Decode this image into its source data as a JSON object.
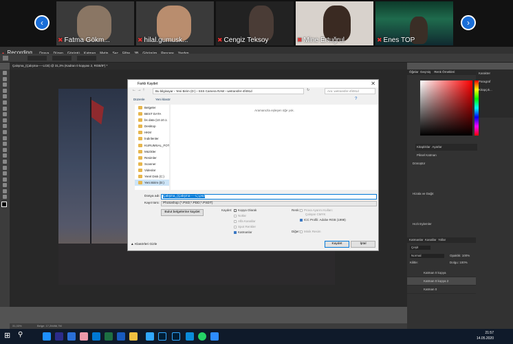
{
  "zoom": {
    "recording_label": "Recording",
    "participants": [
      {
        "name": "Fatma Gökm..."
      },
      {
        "name": "hilal.gumusk..."
      },
      {
        "name": "Cengiz Teksoy"
      },
      {
        "name": "Mine Ertuğrul"
      },
      {
        "name": "Enes TOP"
      }
    ],
    "prev_icon": "chevron-left",
    "next_icon": "chevron-right"
  },
  "ps": {
    "menu": [
      "Dosya",
      "Düzen",
      "Görüntü",
      "Katman",
      "Metin",
      "Seç",
      "Filtre",
      "3B",
      "Görünüm",
      "Pencere",
      "Yardım"
    ],
    "doc_tab": "Çalışma_(Çalışma-----LCB) @ 31,3% (Kadran 0 kopyası 2, RGB/8*) *",
    "status_zoom": "31,33%",
    "status_info": "Belge: 17,2M/86,7M",
    "right": {
      "tabs1": [
        "Kitaplıklar",
        "Ayarlar"
      ],
      "tabs2": [
        "Öğelar",
        "Geçmiş"
      ],
      "color_tab": "Renk Örnekleri",
      "side_items": [
        "Karakter",
        "Paragraf",
        "Kitapçık..."
      ],
      "props_tab": "Özellikler",
      "props_title": "Piksel Katman",
      "transform_label": "Dönüştür",
      "align_label": "Hizala ve Dağıt",
      "fx_label": "Hızlı Eylemler",
      "layers_tabs": [
        "Katmanlar",
        "Kanallar",
        "Yollar"
      ],
      "blend_mode": "Normal",
      "opacity_label": "Opaklık:",
      "opacity": "100%",
      "lock_label": "Kilitle:",
      "fill_label": "Dolgu:",
      "fill": "100%",
      "filter_label": "Çeşit",
      "layers": [
        "Katman 0 kopya",
        "Katman 0 kopya 2",
        "Katman 0"
      ]
    }
  },
  "dialog": {
    "title": "Farklı Kaydet",
    "path": [
      "Bu bilgisayar",
      "Yeni Birim (D:)",
      "SSS Camera RAW",
      "wetransfer-4f491d"
    ],
    "search_placeholder": "Ara: wetransfer-4f491d",
    "organize": "Düzenle",
    "new_folder": "Yeni klasör",
    "empty_msg": "Aramanızla eşleşen öğe yok.",
    "nav": [
      "Belgeler",
      "BEST DATA",
      "bs data (10.10.1.",
      "Desktop",
      "HKM",
      "İndirilenler",
      "KURUMSAL_FOT",
      "Müzikler",
      "Resimler",
      "Scanner",
      "Videolar",
      "Yerel Disk (C:)",
      "Yeni Birim (D:)"
    ],
    "filename_label": "Dosya adı:",
    "filename": "Çalışma_(Çalışma-----L).psd",
    "filetype_label": "Kayıt türü:",
    "filetype": "Photoshop (*.PSD;*.PDD;*.PSDT)",
    "cloud_btn": "Bulut belgelerine kaydet",
    "save_group": "Kaydet:",
    "opt_copy": "Kopya Olarak",
    "opt_notes": "Notlar",
    "opt_alpha": "Alfa Kanallar",
    "opt_spot": "Spot Renkler",
    "opt_layers": "Katmanlar",
    "color_group": "Renk:",
    "opt_proof": "Prova Ayarını Kullan:",
    "opt_proof2": "Çalışan CMYK",
    "opt_icc": "ICC Profili: Adobe RGB (1998)",
    "other_group": "Diğer:",
    "opt_thumb": "Minik Resim",
    "hide_folders": "Klasörleri Gizle",
    "save_btn": "Kaydet",
    "cancel_btn": "İptal"
  },
  "taskbar": {
    "time": "21:57",
    "date": "14.05.2020"
  }
}
